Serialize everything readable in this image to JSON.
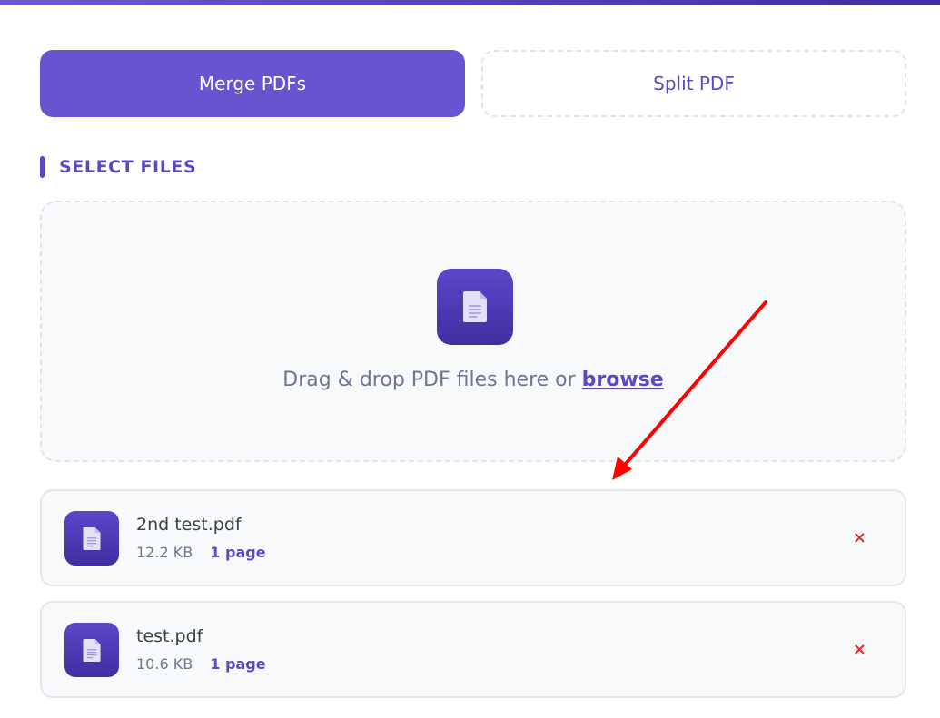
{
  "tabs": [
    {
      "label": "Merge PDFs",
      "active": true
    },
    {
      "label": "Split PDF",
      "active": false
    }
  ],
  "section": {
    "title": "SELECT FILES"
  },
  "dropzone": {
    "icon": "document-icon",
    "text_prefix": "Drag & drop PDF files here or ",
    "browse_label": "browse"
  },
  "files": [
    {
      "name": "2nd test.pdf",
      "size": "12.2 KB",
      "pages": "1 page",
      "remove_label": "×"
    },
    {
      "name": "test.pdf",
      "size": "10.6 KB",
      "pages": "1 page",
      "remove_label": "×"
    }
  ],
  "colors": {
    "accent": "#6854d0",
    "accent_dark": "#3f2ea0",
    "remove": "#d93030",
    "annotation_arrow": "#ff0000"
  }
}
